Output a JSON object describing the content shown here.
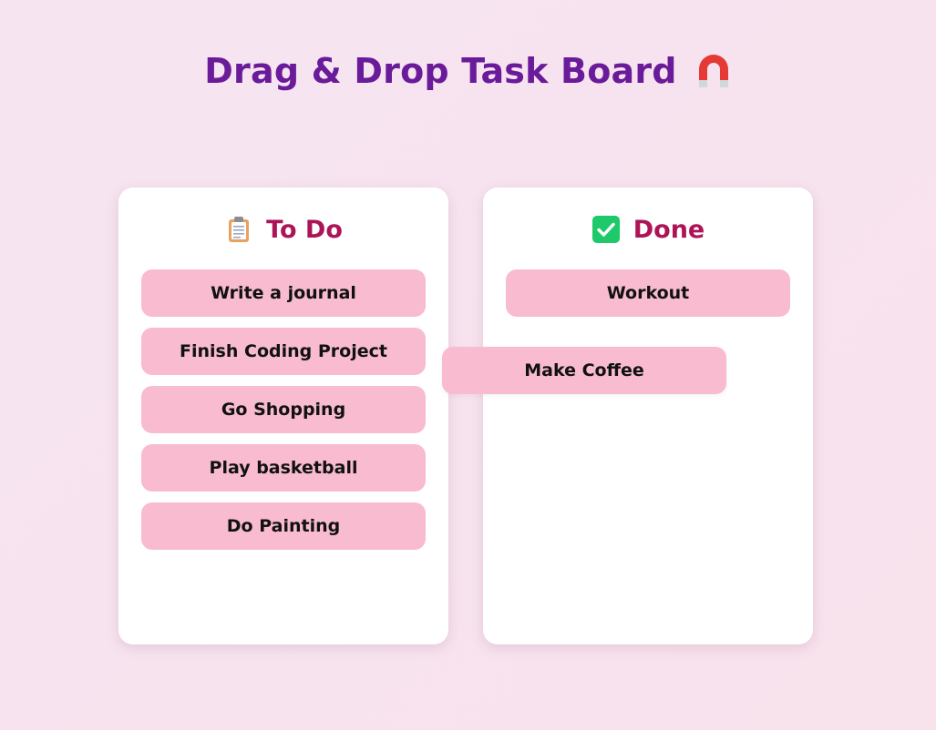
{
  "page": {
    "title": "Drag & Drop Task Board",
    "title_icon": "magnet-icon"
  },
  "columns": {
    "todo": {
      "title": "To Do",
      "icon": "clipboard-icon",
      "tasks": [
        "Write a journal",
        "Finish Coding Project",
        "Go Shopping",
        "Play basketball",
        "Do Painting"
      ]
    },
    "done": {
      "title": "Done",
      "icon": "check-box-icon",
      "tasks": [
        "Workout"
      ]
    }
  },
  "dragging_task": {
    "label": "Make Coffee"
  },
  "colors": {
    "title": "#6a1b9a",
    "column_title": "#ad1457",
    "task_bg": "#f8bbd0",
    "check_green": "#1ec96a",
    "magnet_red": "#e53935"
  }
}
